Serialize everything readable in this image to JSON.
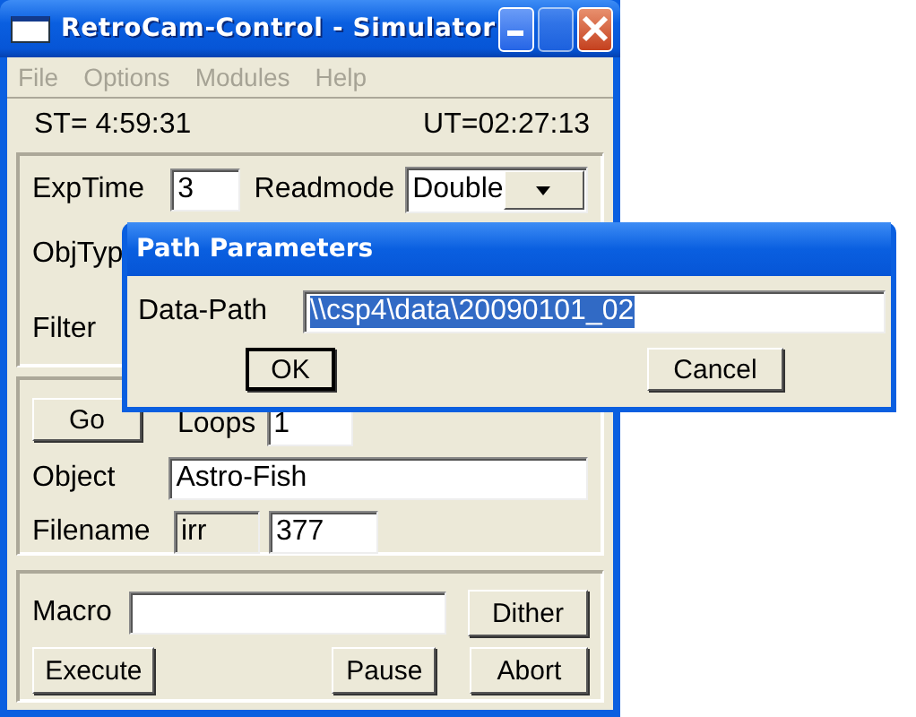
{
  "window": {
    "title": "RetroCam-Control - Simulator"
  },
  "menu": [
    {
      "label": "File",
      "disabled": true
    },
    {
      "label": "Options",
      "disabled": true
    },
    {
      "label": "Modules",
      "disabled": true
    },
    {
      "label": "Help",
      "disabled": true
    }
  ],
  "status": {
    "st": "ST= 4:59:31",
    "ut": "UT=02:27:13"
  },
  "camera": {
    "exptime_label": "ExpTime",
    "exptime": "3",
    "readmode_label": "Readmode",
    "readmode": "Double",
    "objtype_label": "ObjTyp",
    "filter_label": "Filter"
  },
  "sequence": {
    "go": "Go",
    "loops_label": "Loops",
    "loops": "1",
    "object_label": "Object",
    "object": "Astro-Fish",
    "filename_label": "Filename",
    "filename_prefix": "irr",
    "filename_prefix_disabled": true,
    "filename_number": "377"
  },
  "macro": {
    "label": "Macro",
    "dither": "Dither",
    "execute": "Execute",
    "pause": "Pause",
    "abort": "Abort"
  },
  "dialog": {
    "title": "Path Parameters",
    "field_label": "Data-Path",
    "value": "\\\\csp4\\data\\20090101_02",
    "value_selected": true,
    "ok": "OK",
    "cancel": "Cancel"
  }
}
